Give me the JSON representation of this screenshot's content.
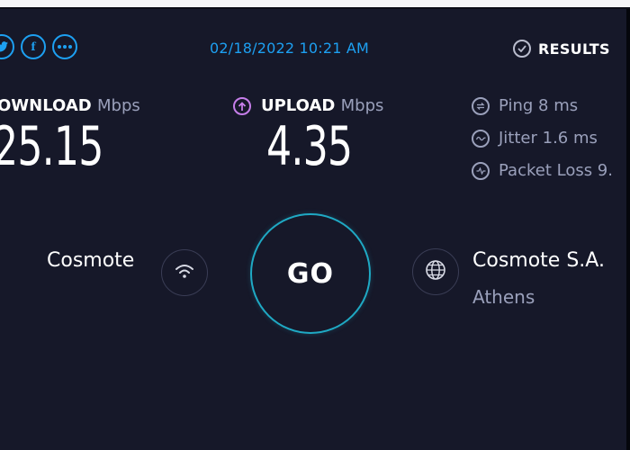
{
  "header": {
    "social": [
      {
        "icon": "twitter-icon"
      },
      {
        "icon": "facebook-icon",
        "glyph": "f"
      },
      {
        "icon": "more-icon"
      }
    ],
    "datetime": "02/18/2022 10:21 AM",
    "results_label": "RESULTS"
  },
  "download": {
    "label": "OWNLOAD",
    "unit": "Mbps",
    "value": "25.15"
  },
  "upload": {
    "label": "UPLOAD",
    "unit": "Mbps",
    "value": "4.35"
  },
  "stats": {
    "ping": "Ping  8 ms",
    "jitter": "Jitter  1.6 ms",
    "packet_loss": "Packet Loss  9."
  },
  "provider": {
    "name": "Cosmote"
  },
  "go_label": "GO",
  "server": {
    "name": "Cosmote S.A.",
    "city": "Athens"
  },
  "colors": {
    "background": "#161829",
    "accent_blue": "#1da0f2",
    "upload_purple": "#c67eea",
    "go_ring": "#1fa9c4",
    "muted": "#9aa0bb"
  }
}
